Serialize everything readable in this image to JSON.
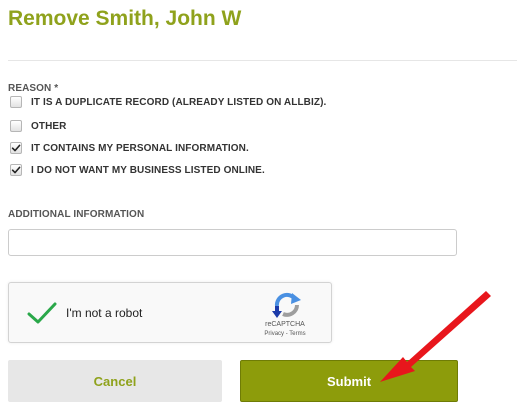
{
  "page": {
    "title": "Remove Smith, John W"
  },
  "form": {
    "reason_label": "REASON *",
    "reason_options": [
      {
        "label": "IT IS A DUPLICATE RECORD (ALREADY LISTED ON ALLBIZ).",
        "checked": false
      },
      {
        "label": "OTHER",
        "checked": false
      },
      {
        "label": "IT CONTAINS MY PERSONAL INFORMATION.",
        "checked": true
      },
      {
        "label": "I DO NOT WANT MY BUSINESS LISTED ONLINE.",
        "checked": true
      }
    ],
    "additional_info_label": "ADDITIONAL INFORMATION",
    "additional_info_value": "",
    "additional_info_placeholder": ""
  },
  "recaptcha": {
    "label": "I'm not a robot",
    "checked": true,
    "brand": "reCAPTCHA",
    "privacy_link": "Privacy",
    "separator": " - ",
    "terms_link": "Terms"
  },
  "buttons": {
    "cancel_label": "Cancel",
    "submit_label": "Submit"
  },
  "colors": {
    "brand_green": "#8fa21c",
    "submit_bg": "#8d9c0b",
    "checkmark_green": "#2aa84a",
    "annotation_red": "#e8161c"
  },
  "icons": {
    "checkbox_checked": "check-icon",
    "recaptcha_check": "check-icon",
    "recaptcha_logo": "recaptcha-logo-icon",
    "annotation": "red-arrow-icon"
  }
}
